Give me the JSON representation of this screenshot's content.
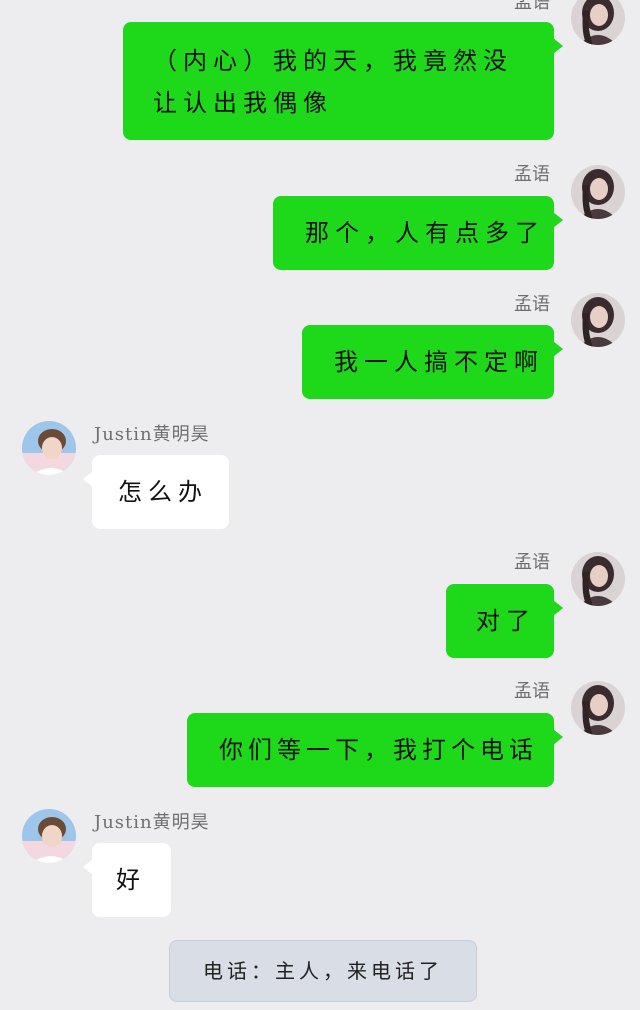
{
  "messages": [
    {
      "sender": "孟语",
      "text": "（内心）我的天，我竟然没让认出我偶像"
    },
    {
      "sender": "孟语",
      "text": "那个，人有点多了"
    },
    {
      "sender": "孟语",
      "text": "我一人搞不定啊"
    },
    {
      "sender": "Justin黄明昊",
      "text": "怎么办"
    },
    {
      "sender": "孟语",
      "text": "对了"
    },
    {
      "sender": "孟语",
      "text": "你们等一下，我打个电话"
    },
    {
      "sender": "Justin黄明昊",
      "text": "好"
    }
  ],
  "system_notice": "电话：主人，来电话了",
  "colors": {
    "background": "#ededf0",
    "sent_bubble": "#1ed91a",
    "received_bubble": "#ffffff",
    "notice_bubble": "#d9dde6"
  },
  "avatars": {
    "self": "girl-avatar-icon",
    "contact": "boy-avatar-icon"
  }
}
